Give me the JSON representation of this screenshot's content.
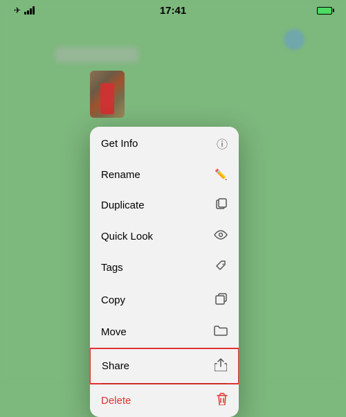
{
  "statusBar": {
    "time": "17:41"
  },
  "contextMenu": {
    "items": [
      {
        "id": "get-info",
        "label": "Get Info",
        "icon": "ℹ"
      },
      {
        "id": "rename",
        "label": "Rename",
        "icon": "✏"
      },
      {
        "id": "duplicate",
        "label": "Duplicate",
        "icon": "⧉"
      },
      {
        "id": "quick-look",
        "label": "Quick Look",
        "icon": "👁"
      },
      {
        "id": "tags",
        "label": "Tags",
        "icon": "🏷"
      },
      {
        "id": "copy",
        "label": "Copy",
        "icon": "📋"
      },
      {
        "id": "move",
        "label": "Move",
        "icon": "📁"
      },
      {
        "id": "share",
        "label": "Share",
        "icon": "⬆"
      },
      {
        "id": "delete",
        "label": "Delete",
        "icon": "🗑"
      }
    ]
  }
}
